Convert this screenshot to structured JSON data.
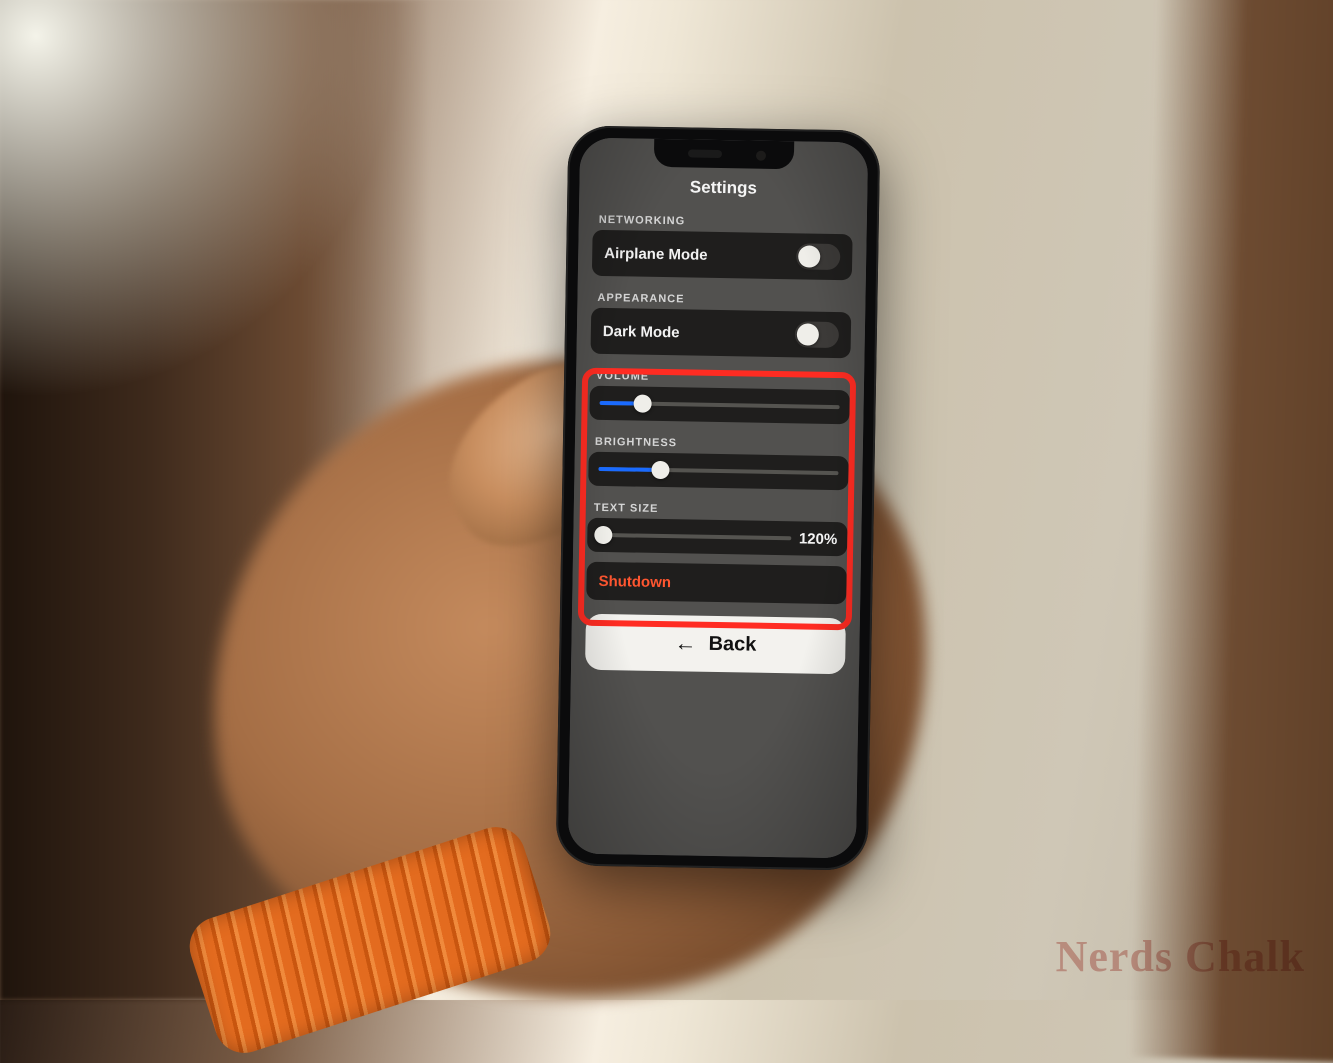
{
  "watermark": "Nerds Chalk",
  "settings": {
    "title": "Settings",
    "networking": {
      "header": "NETWORKING",
      "airplane_label": "Airplane Mode",
      "airplane_on": false
    },
    "appearance": {
      "header": "APPEARANCE",
      "dark_label": "Dark Mode",
      "dark_on": false
    },
    "volume": {
      "header": "VOLUME",
      "percent": 18
    },
    "brightness": {
      "header": "BRIGHTNESS",
      "percent": 26
    },
    "textsize": {
      "header": "TEXT SIZE",
      "percent": 3,
      "value_label": "120%"
    },
    "shutdown_label": "Shutdown",
    "back_label": "Back"
  }
}
